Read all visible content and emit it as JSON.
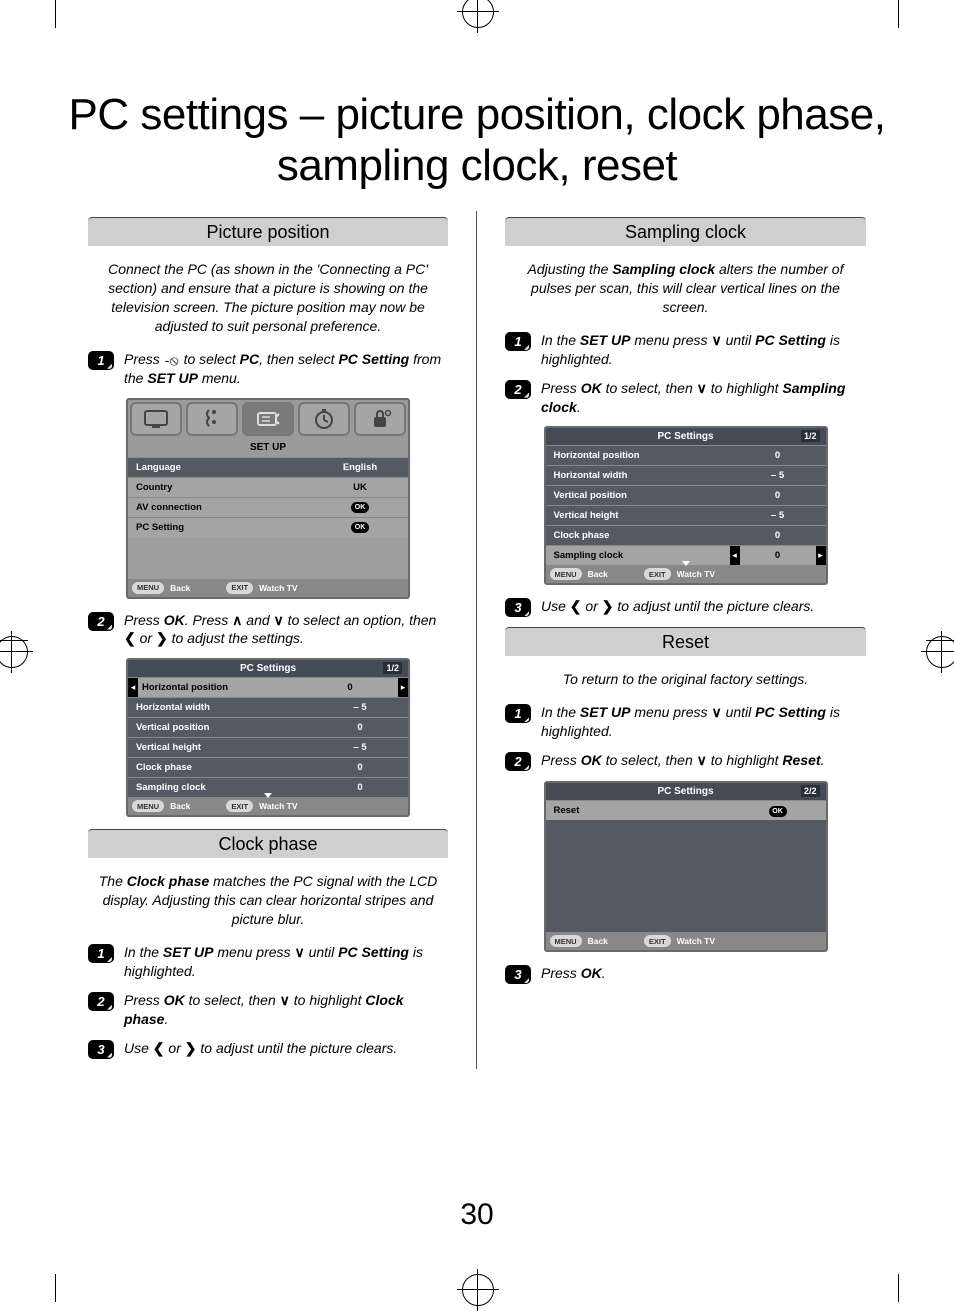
{
  "page_number": "30",
  "main_title": "PC settings – picture position, clock phase, sampling clock, reset",
  "sections": {
    "picture_position": {
      "title": "Picture position",
      "intro": "Connect the PC (as shown in the 'Connecting a PC' section) and ensure that a picture is showing on the television screen. The picture position may now be adjusted to suit personal preference.",
      "step1_a": "Press ",
      "step1_b": " to select ",
      "step1_c": ", then select ",
      "step1_d": " from the ",
      "step1_e": " menu.",
      "step1_pc": "PC",
      "step1_pcsetting": "PC Setting",
      "step1_setup": "SET UP",
      "step2_a": "Press ",
      "step2_ok": "OK",
      "step2_b": ". Press ",
      "step2_c": " and ",
      "step2_d": " to select an option, then ",
      "step2_e": " or ",
      "step2_f": " to adjust the settings."
    },
    "clock_phase": {
      "title": "Clock phase",
      "intro_a": "The ",
      "intro_bold": "Clock phase",
      "intro_b": " matches the PC signal with the LCD display. Adjusting this can clear horizontal stripes and picture blur.",
      "step1_a": "In the ",
      "step1_setup": "SET UP",
      "step1_b": " menu press ",
      "step1_c": " until ",
      "step1_pcsetting": "PC Setting",
      "step1_d": " is highlighted.",
      "step2_a": "Press ",
      "step2_ok": "OK",
      "step2_b": " to select, then ",
      "step2_c": " to highlight ",
      "step2_bold": "Clock phase",
      "step2_d": ".",
      "step3_a": "Use ",
      "step3_b": " or ",
      "step3_c": " to adjust until the picture clears."
    },
    "sampling_clock": {
      "title": "Sampling clock",
      "intro_a": "Adjusting the ",
      "intro_bold": "Sampling clock",
      "intro_b": " alters the number of pulses per scan, this will clear vertical lines on the screen.",
      "step1_a": "In the ",
      "step1_setup": "SET UP",
      "step1_b": " menu press ",
      "step1_c": " until ",
      "step1_pcsetting": "PC Setting",
      "step1_d": " is highlighted.",
      "step2_a": "Press ",
      "step2_ok": "OK",
      "step2_b": " to select, then ",
      "step2_c": " to highlight ",
      "step2_bold": "Sampling clock",
      "step2_d": ".",
      "step3_a": "Use ",
      "step3_b": " or ",
      "step3_c": " to adjust until the picture clears."
    },
    "reset": {
      "title": "Reset",
      "intro": "To return to the original factory settings.",
      "step1_a": "In the ",
      "step1_setup": "SET UP",
      "step1_b": " menu press ",
      "step1_c": " until ",
      "step1_pcsetting": "PC Setting",
      "step1_d": " is highlighted.",
      "step2_a": "Press ",
      "step2_ok": "OK",
      "step2_b": " to select, then ",
      "step2_c": " to highlight ",
      "step2_bold": "Reset",
      "step2_d": ".",
      "step3_a": "Press ",
      "step3_ok": "OK",
      "step3_b": "."
    }
  },
  "osd": {
    "setup": {
      "title": "SET UP",
      "rows": [
        {
          "lab": "Language",
          "val": "English",
          "ok": false
        },
        {
          "lab": "Country",
          "val": "UK",
          "ok": false
        },
        {
          "lab": "AV connection",
          "val": "OK",
          "ok": true
        },
        {
          "lab": "PC Setting",
          "val": "OK",
          "ok": true
        }
      ],
      "foot_menu": "MENU",
      "foot_back": "Back",
      "foot_exit": "EXIT",
      "foot_watch": "Watch TV"
    },
    "pc_settings": {
      "title": "PC Settings",
      "page": "1/2",
      "rows": [
        {
          "lab": "Horizontal position",
          "val": "0"
        },
        {
          "lab": "Horizontal width",
          "val": "– 5"
        },
        {
          "lab": "Vertical position",
          "val": "0"
        },
        {
          "lab": "Vertical height",
          "val": "– 5"
        },
        {
          "lab": "Clock phase",
          "val": "0"
        },
        {
          "lab": "Sampling clock",
          "val": "0"
        }
      ],
      "foot_menu": "MENU",
      "foot_back": "Back",
      "foot_exit": "EXIT",
      "foot_watch": "Watch TV"
    },
    "pc_settings_sampling": {
      "title": "PC Settings",
      "page": "1/2",
      "rows": [
        {
          "lab": "Horizontal position",
          "val": "0"
        },
        {
          "lab": "Horizontal width",
          "val": "– 5"
        },
        {
          "lab": "Vertical position",
          "val": "0"
        },
        {
          "lab": "Vertical height",
          "val": "– 5"
        },
        {
          "lab": "Clock phase",
          "val": "0"
        },
        {
          "lab": "Sampling clock",
          "val": "0"
        }
      ],
      "foot_menu": "MENU",
      "foot_back": "Back",
      "foot_exit": "EXIT",
      "foot_watch": "Watch TV"
    },
    "pc_reset": {
      "title": "PC Settings",
      "page": "2/2",
      "row_lab": "Reset",
      "foot_menu": "MENU",
      "foot_back": "Back",
      "foot_exit": "EXIT",
      "foot_watch": "Watch TV"
    }
  },
  "symbols": {
    "up": "∧",
    "down": "∨",
    "left": "❮",
    "right": "❯",
    "input": "⊖"
  }
}
